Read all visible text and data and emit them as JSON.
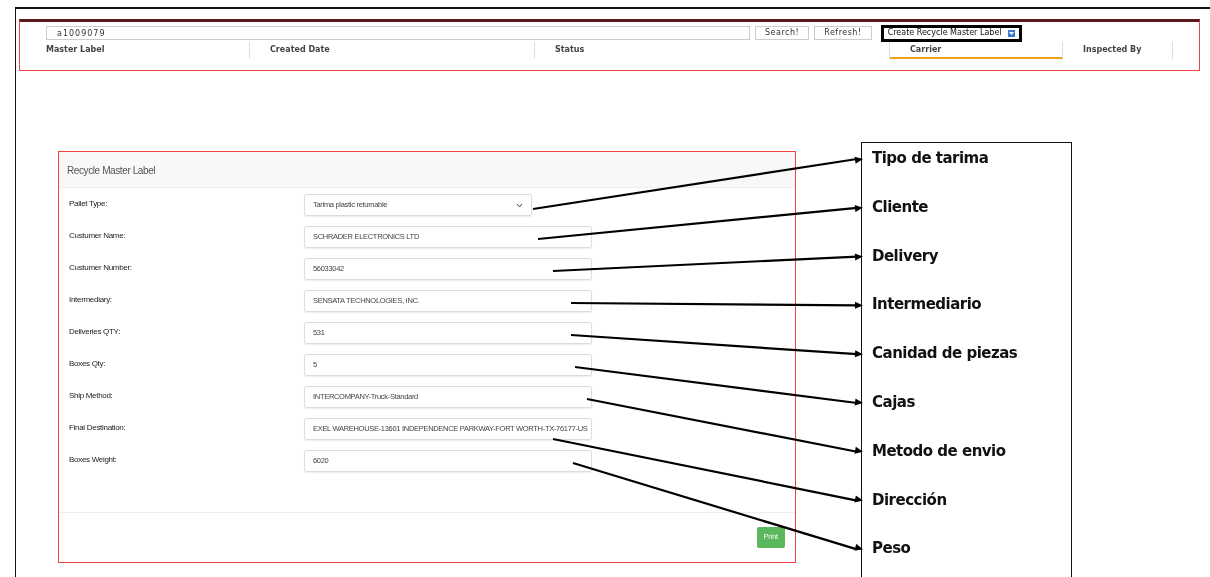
{
  "toolbar": {
    "search": {
      "value": "a1009079"
    },
    "buttons": [
      "Search!",
      "Refresh!"
    ],
    "create_select": {
      "value": "Create Recycle Master Label",
      "highlighted": true
    }
  },
  "table": {
    "columns": [
      {
        "label": "Master Label",
        "selected": false
      },
      {
        "label": "Created Date",
        "selected": false
      },
      {
        "label": "Status",
        "selected": false
      },
      {
        "label": "Carrier",
        "selected": true
      },
      {
        "label": "Inspected By",
        "selected": false
      }
    ]
  },
  "form": {
    "title": "Recycle Master Label",
    "fields": [
      {
        "kind": "select",
        "label": "Pallet Type:",
        "value": "Tarima plastic returnable"
      },
      {
        "kind": "input",
        "label": "Custumer Name:",
        "value": "SCHRADER ELECTRONICS LTD"
      },
      {
        "kind": "input",
        "label": "Custumer Number:",
        "value": "56033042"
      },
      {
        "kind": "input",
        "label": "Intermediary:",
        "value": "SENSATA TECHNOLOGIES, INC."
      },
      {
        "kind": "input",
        "label": "Deliveries QTY:",
        "value": "531"
      },
      {
        "kind": "input",
        "label": "Boxes Qty:",
        "value": "5"
      },
      {
        "kind": "input",
        "label": "Ship Method:",
        "value": "INTERCOMPANY-Truck-Standard"
      },
      {
        "kind": "input",
        "label": "Final Destination:",
        "value": "EXEL WAREHOUSE-13601 INDEPENDENCE PARKWAY-FORT WORTH-TX-76177-US"
      },
      {
        "kind": "input",
        "label": "Boxes Weight:",
        "value": "6020"
      }
    ],
    "print_button": "Print"
  },
  "annotations": [
    {
      "text": "Tipo de tarima"
    },
    {
      "text": "Cliente"
    },
    {
      "text": "Delivery"
    },
    {
      "text": "Intermediario"
    },
    {
      "text": "Canidad de piezas"
    },
    {
      "text": "Cajas"
    },
    {
      "text": "Metodo de envio"
    },
    {
      "text": "Dirección"
    },
    {
      "text": "Peso"
    }
  ]
}
